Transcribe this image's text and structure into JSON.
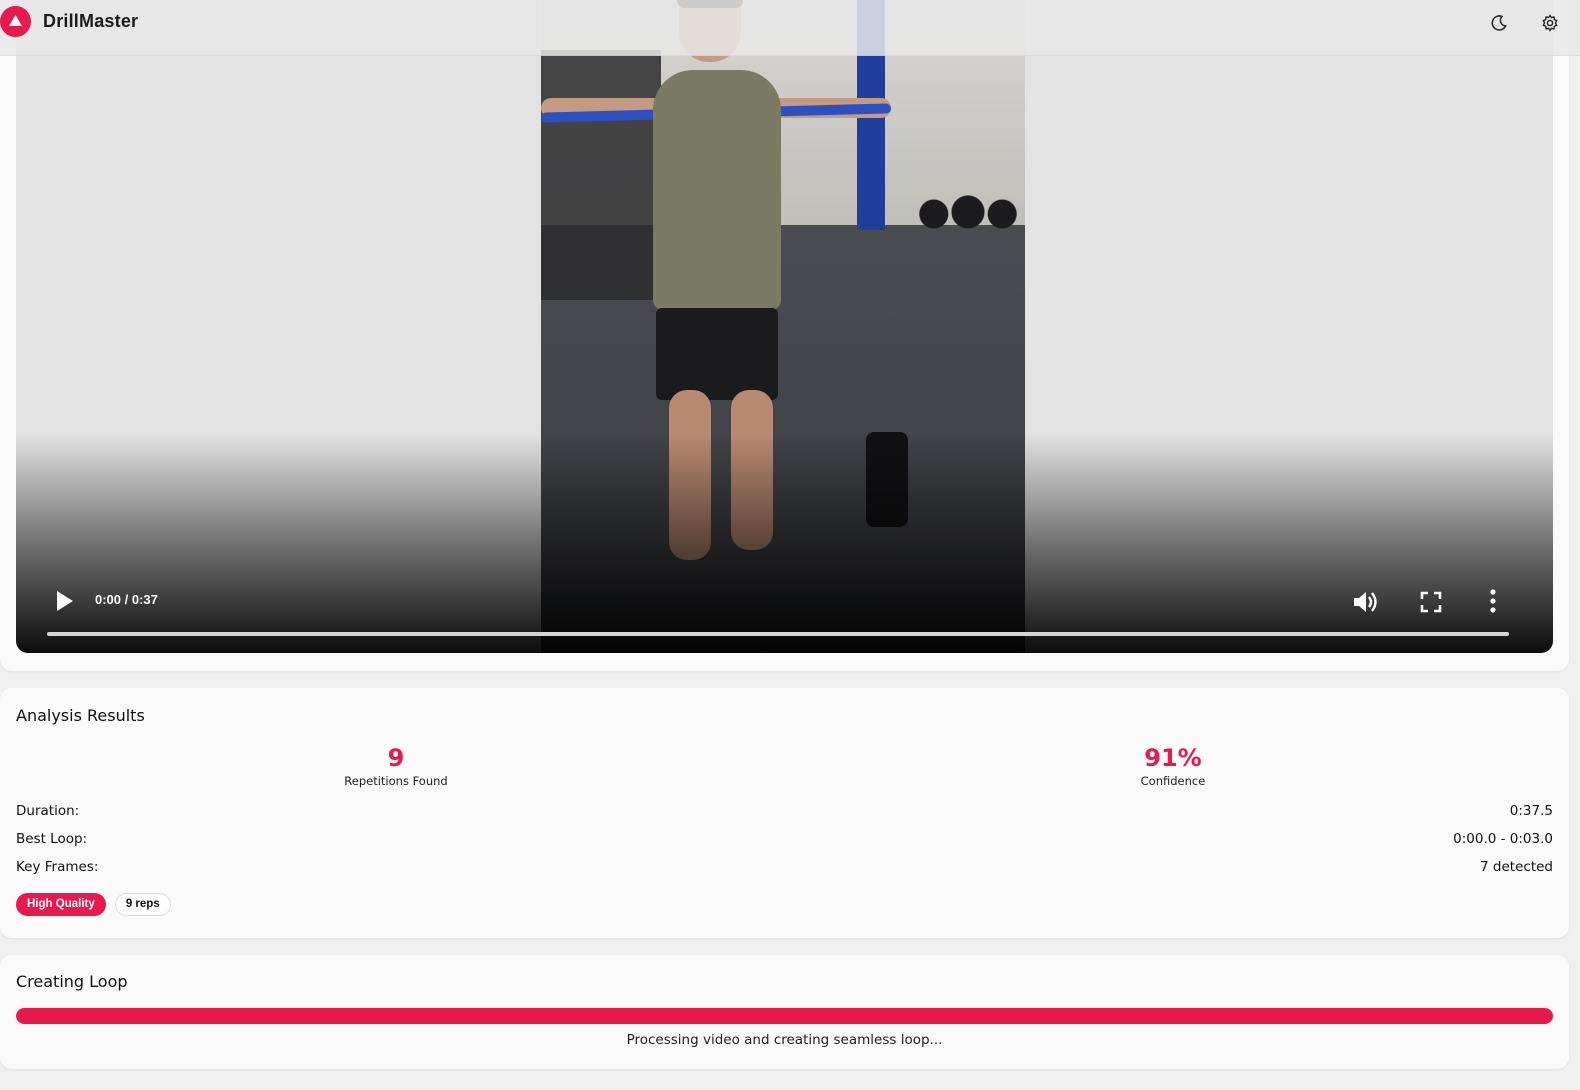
{
  "header": {
    "app_title": "DrillMaster",
    "logo_icon": "triangle-up-icon",
    "theme_toggle_icon": "moon-icon",
    "settings_icon": "gear-icon"
  },
  "video": {
    "time_display": "0:00 / 0:37",
    "play_icon": "play-icon",
    "volume_icon": "volume-icon",
    "fullscreen_icon": "fullscreen-icon",
    "more_icon": "more-vertical-icon",
    "progress": 0
  },
  "analysis": {
    "title": "Analysis Results",
    "stats": [
      {
        "value": "9",
        "label": "Repetitions Found"
      },
      {
        "value": "91%",
        "label": "Confidence"
      }
    ],
    "rows": [
      {
        "label": "Duration:",
        "value": "0:37.5"
      },
      {
        "label": "Best Loop:",
        "value": "0:00.0 - 0:03.0"
      },
      {
        "label": "Key Frames:",
        "value": "7 detected"
      }
    ],
    "badges": [
      "High Quality",
      "9 reps"
    ]
  },
  "loop": {
    "title": "Creating Loop",
    "progress": 1.0,
    "status_text": "Processing video and creating seamless loop..."
  },
  "colors": {
    "accent": "#e8194d",
    "page_background": "#efefef",
    "card_background": "#fafafa"
  }
}
